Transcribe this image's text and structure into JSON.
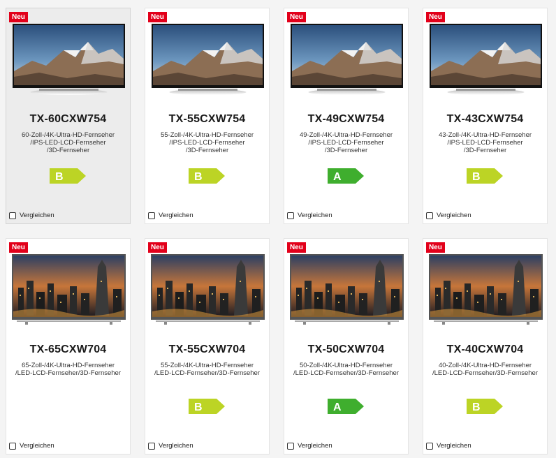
{
  "colors": {
    "badge": "#e2001a",
    "energy_b": "#bcd425",
    "energy_a": "#3fae2e"
  },
  "products": [
    {
      "badge": "Neu",
      "model": "TX-60CXW754",
      "desc": [
        "60-Zoll-/4K-Ultra-HD-Fernseher",
        "/IPS-LED-LCD-Fernseher",
        "/3D-Fernseher"
      ],
      "energy": "B",
      "compare": "Vergleichen",
      "image": "mountain-scene",
      "selected": true
    },
    {
      "badge": "Neu",
      "model": "TX-55CXW754",
      "desc": [
        "55-Zoll-/4K-Ultra-HD-Fernseher",
        "/IPS-LED-LCD-Fernseher",
        "/3D-Fernseher"
      ],
      "energy": "B",
      "compare": "Vergleichen",
      "image": "mountain-scene",
      "selected": false
    },
    {
      "badge": "Neu",
      "model": "TX-49CXW754",
      "desc": [
        "49-Zoll-/4K-Ultra-HD-Fernseher",
        "/IPS-LED-LCD-Fernseher",
        "/3D-Fernseher"
      ],
      "energy": "A",
      "compare": "Vergleichen",
      "image": "mountain-scene",
      "selected": false
    },
    {
      "badge": "Neu",
      "model": "TX-43CXW754",
      "desc": [
        "43-Zoll-/4K-Ultra-HD-Fernseher",
        "/IPS-LED-LCD-Fernseher",
        "/3D-Fernseher"
      ],
      "energy": "B",
      "compare": "Vergleichen",
      "image": "mountain-scene",
      "selected": false
    },
    {
      "badge": "Neu",
      "model": "TX-65CXW704",
      "desc": [
        "65-Zoll-/4K-Ultra-HD-Fernseher",
        "/LED-LCD-Fernseher/3D-Fernseher"
      ],
      "energy": "",
      "compare": "Vergleichen",
      "image": "city-night-scene",
      "selected": false
    },
    {
      "badge": "Neu",
      "model": "TX-55CXW704",
      "desc": [
        "55-Zoll-/4K-Ultra-HD-Fernseher",
        "/LED-LCD-Fernseher/3D-Fernseher"
      ],
      "energy": "B",
      "compare": "Vergleichen",
      "image": "city-night-scene",
      "selected": false
    },
    {
      "badge": "Neu",
      "model": "TX-50CXW704",
      "desc": [
        "50-Zoll-/4K-Ultra-HD-Fernseher",
        "/LED-LCD-Fernseher/3D-Fernseher"
      ],
      "energy": "A",
      "compare": "Vergleichen",
      "image": "city-night-scene",
      "selected": false
    },
    {
      "badge": "Neu",
      "model": "TX-40CXW704",
      "desc": [
        "40-Zoll-/4K-Ultra-HD-Fernseher",
        "/LED-LCD-Fernseher/3D-Fernseher"
      ],
      "energy": "B",
      "compare": "Vergleichen",
      "image": "city-night-scene",
      "selected": false
    }
  ]
}
